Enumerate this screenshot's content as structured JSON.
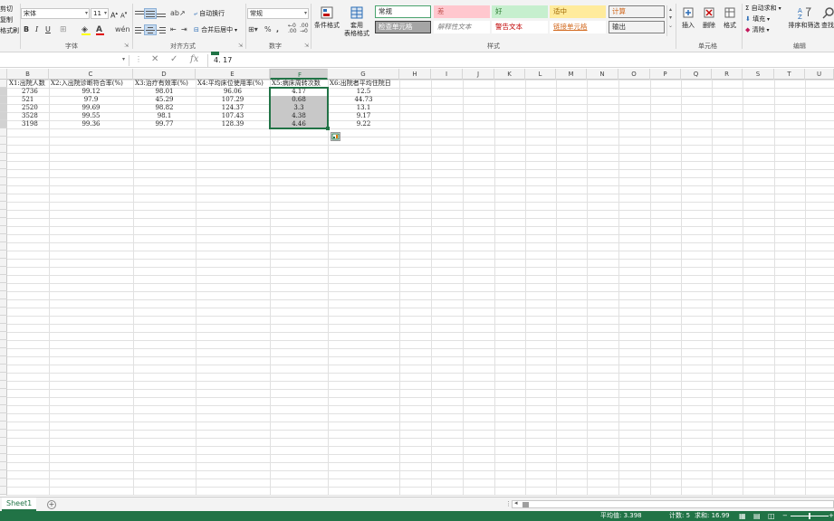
{
  "ribbon": {
    "clipboard": [
      "剪切",
      "复制",
      "格式刷"
    ],
    "font_name": "宋体",
    "font_size": "11",
    "wrap_text": "自动换行",
    "merge_center": "合并后居中",
    "number_format": "常规",
    "conditional_format": "条件格式",
    "table_format": [
      "套用",
      "表格格式"
    ],
    "styles": [
      {
        "label": "常规",
        "bg": "#ffffff",
        "fg": "#222222",
        "border": "#4aa36e"
      },
      {
        "label": "差",
        "bg": "#ffc7ce",
        "fg": "#c0504d",
        "border": "#ffc7ce"
      },
      {
        "label": "好",
        "bg": "#c6efce",
        "fg": "#2e7d32",
        "border": "#c6efce"
      },
      {
        "label": "适中",
        "bg": "#ffeb9c",
        "fg": "#9c6500",
        "border": "#ffeb9c"
      },
      {
        "label": "计算",
        "bg": "#f2f2f2",
        "fg": "#d2691e",
        "border": "#7f7f7f"
      },
      {
        "label": "检查单元格",
        "bg": "#a5a5a5",
        "fg": "#ffffff",
        "border": "#3f3f3f"
      },
      {
        "label": "解释性文本",
        "bg": "#ffffff",
        "fg": "#7f7f7f",
        "border": "#ffffff"
      },
      {
        "label": "警告文本",
        "bg": "#ffffff",
        "fg": "#c00000",
        "border": "#ffffff"
      },
      {
        "label": "链接单元格",
        "bg": "#ffffff",
        "fg": "#d2691e",
        "border": "#ffffff"
      },
      {
        "label": "输出",
        "bg": "#f2f2f2",
        "fg": "#333333",
        "border": "#7f7f7f"
      }
    ],
    "insert": "插入",
    "delete": "删除",
    "format": "格式",
    "autosum": "自动求和",
    "fill": "填充",
    "clear": "清除",
    "sort_filter": "排序和筛选",
    "find_select": "查找",
    "groups": {
      "font": "字体",
      "alignment": "对齐方式",
      "number": "数字",
      "styles": "样式",
      "cells": "单元格",
      "editing": "编辑"
    }
  },
  "formula_bar": {
    "cancel": "✕",
    "enter": "✓",
    "fx": "fx",
    "value": "4. 17"
  },
  "columns": [
    "B",
    "C",
    "D",
    "E",
    "F",
    "G",
    "H",
    "I",
    "J",
    "K",
    "L",
    "M",
    "N",
    "O",
    "P",
    "Q",
    "R",
    "S",
    "T",
    "U"
  ],
  "selected_column": "F",
  "headers": [
    "X1:出院人数",
    "X2:入出院诊断符合率(%)",
    "X3:治疗有效率(%)",
    "X4:平均床位使用率(%)",
    "X5:病床周转次数",
    "X6:出院者平均住院日"
  ],
  "rows": [
    [
      "2736",
      "99.12",
      "98.01",
      "96.06",
      "4.17",
      "12.5"
    ],
    [
      "521",
      "97.9",
      "45.29",
      "107.29",
      "0.68",
      "44.73"
    ],
    [
      "2520",
      "99.69",
      "98.82",
      "124.37",
      "3.3",
      "13.1"
    ],
    [
      "3528",
      "99.55",
      "98.1",
      "107.43",
      "4.38",
      "9.17"
    ],
    [
      "3198",
      "99.36",
      "99.77",
      "128.39",
      "4.46",
      "9.22"
    ]
  ],
  "sheet_tab": "Sheet1",
  "status": {
    "average": "平均值: 3.398",
    "count": "计数: 5",
    "sum": "求和: 16.99"
  }
}
